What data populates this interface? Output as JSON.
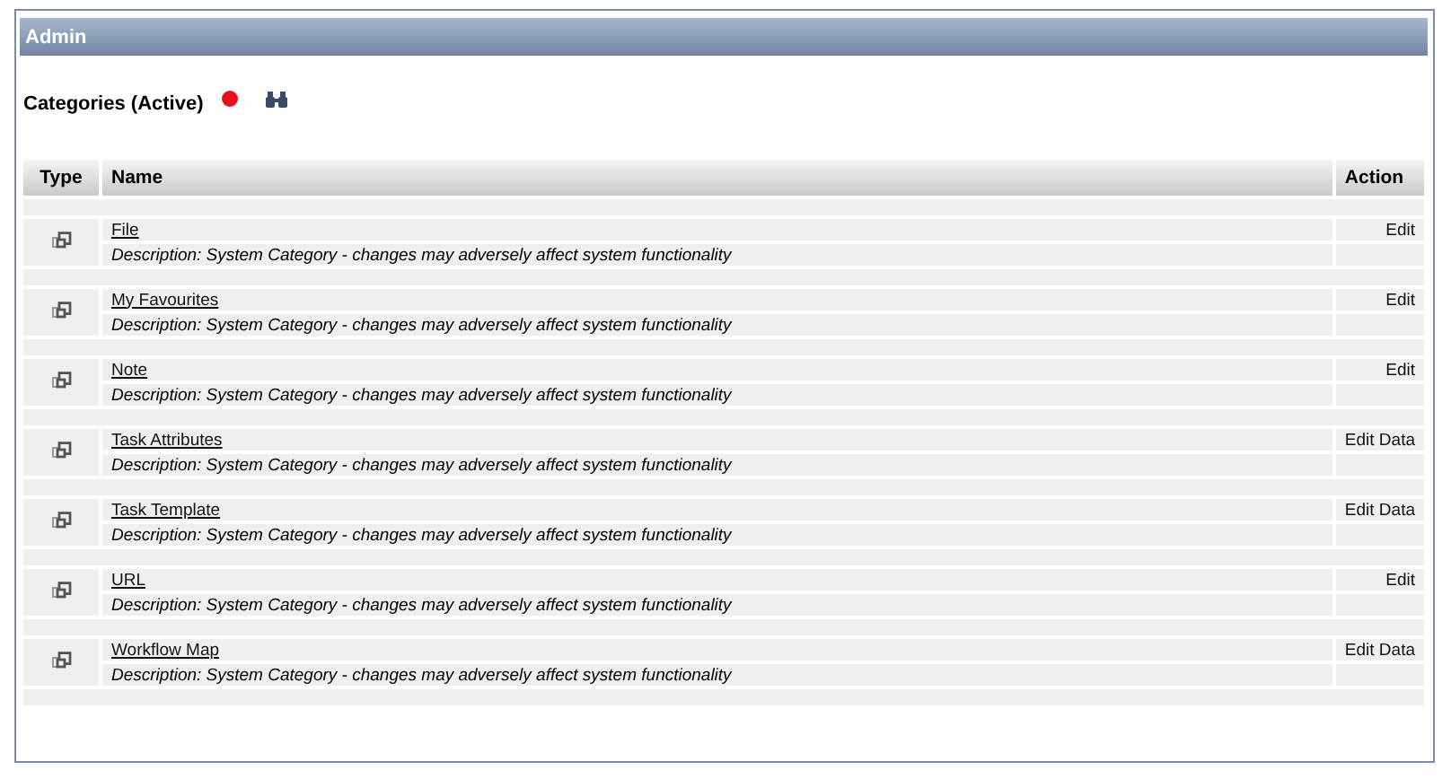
{
  "panel": {
    "title": "Admin"
  },
  "section": {
    "title": "Categories (Active)"
  },
  "table": {
    "columns": [
      "Type",
      "Name",
      "Action"
    ],
    "rows": [
      {
        "name": "File",
        "description": "Description: System Category - changes may adversely affect system functionality",
        "action": "Edit"
      },
      {
        "name": "My Favourites",
        "description": "Description: System Category - changes may adversely affect system functionality",
        "action": "Edit"
      },
      {
        "name": "Note",
        "description": "Description: System Category - changes may adversely affect system functionality",
        "action": "Edit"
      },
      {
        "name": "Task Attributes",
        "description": "Description: System Category - changes may adversely affect system functionality",
        "action": "Edit Data"
      },
      {
        "name": "Task Template",
        "description": "Description: System Category - changes may adversely affect system functionality",
        "action": "Edit Data"
      },
      {
        "name": "URL",
        "description": "Description: System Category - changes may adversely affect system functionality",
        "action": "Edit"
      },
      {
        "name": "Workflow Map",
        "description": "Description: System Category - changes may adversely affect system functionality",
        "action": "Edit Data"
      }
    ]
  }
}
